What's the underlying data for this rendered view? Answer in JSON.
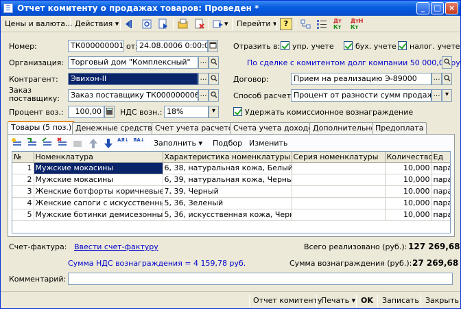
{
  "window": {
    "title": "Отчет комитенту о продажах товаров: Проведен *"
  },
  "toolbar": {
    "prices": "Цены и валюта...",
    "actions": "Действия",
    "goto": "Перейти",
    "help": "?"
  },
  "header": {
    "number_label": "Номер:",
    "number_value": "ТК000000001",
    "date_label": "от:",
    "date_value": "24.08.0006  0:00:00",
    "reflect_label": "Отразить в:",
    "reflect_mgmt": "упр. учете",
    "reflect_acc": "бух. учете",
    "reflect_tax": "налог. учете",
    "org_label": "Организация:",
    "org_value": "Торговый дом \"Комплексный\"",
    "debt_link": "По сделке с комитентом долг компании 50 000,00 руб.",
    "contractor_label": "Контрагент:",
    "contractor_value": "Эвихон-II",
    "contract_label": "Договор:",
    "contract_value": "Прием на реализацию Э-89000",
    "order_label": "Заказ поставщику:",
    "order_value": "Заказ поставщику ТК000000006 от 1",
    "calc_label": "Способ расчета:",
    "calc_value": "Процент от разности сумм продажи и п",
    "percent_label": "Процент воз.:",
    "percent_value": "100,00",
    "vat_label": "НДС возн.:",
    "vat_value": "18%",
    "withhold_label": "Удержать комиссионное вознаграждение"
  },
  "tabs": [
    {
      "label": "Товары (5 поз.)"
    },
    {
      "label": "Денежные средства"
    },
    {
      "label": "Счет учета расчетов"
    },
    {
      "label": "Счета учета доходов"
    },
    {
      "label": "Дополнительно"
    },
    {
      "label": "Предоплата"
    }
  ],
  "grid_toolbar": {
    "fill": "Заполнить",
    "select": "Подбор",
    "change": "Изменить"
  },
  "table": {
    "columns": [
      "№",
      "Номенклатура",
      "Характеристика номенклатуры",
      "Серия номенклатуры",
      "Количество",
      "Ед"
    ],
    "rows": [
      {
        "n": "1",
        "item": "Мужские мокасины",
        "char": "6, 38, натуральная кожа, Белый",
        "series": "",
        "qty": "10,000",
        "unit": "пара"
      },
      {
        "n": "2",
        "item": "Мужские мокасины",
        "char": "6, 39, натуральная кожа, Черный",
        "series": "",
        "qty": "10,000",
        "unit": "пара"
      },
      {
        "n": "3",
        "item": "Женские ботфорты коричневые",
        "char": "7, 39, Черный",
        "series": "",
        "qty": "10,000",
        "unit": "пара"
      },
      {
        "n": "4",
        "item": "Женские сапоги с искусственны...",
        "char": "5, 36, Зеленый",
        "series": "",
        "qty": "10,000",
        "unit": "пара"
      },
      {
        "n": "5",
        "item": "Мужские ботинки демисезонные",
        "char": "5, 36, искусственная кожа, Черный",
        "series": "",
        "qty": "10,000",
        "unit": "пара"
      }
    ]
  },
  "footer": {
    "invoice_label": "Счет-фактура:",
    "invoice_link": "Ввести счет-фактуру",
    "total_label": "Всего реализовано (руб.):",
    "total_value": "127 269,68",
    "vat_link": "Сумма НДС вознаграждения = 4 159,78 руб.",
    "reward_label": "Сумма вознаграждения (руб.):",
    "reward_value": "27 269,68",
    "comment_label": "Комментарий:",
    "comment_value": ""
  },
  "bottom": {
    "report": "Отчет комитенту",
    "print": "Печать",
    "ok": "OK",
    "save": "Записать",
    "close": "Закрыть"
  },
  "colors": {
    "title_bar": "#0a5fe0",
    "selection": "#0a246a",
    "link": "#0000cc"
  }
}
